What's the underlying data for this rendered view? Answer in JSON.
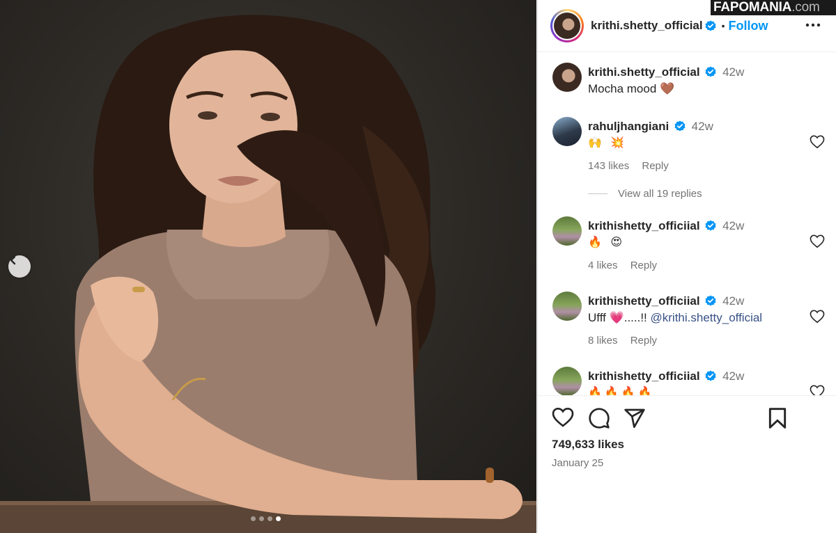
{
  "watermark": {
    "brand": "FAPOMANIA",
    "domain": ".com"
  },
  "post": {
    "author": "krithi.shetty_official",
    "follow_label": "Follow",
    "separator": "•",
    "carousel": {
      "count": 4,
      "active_index": 3
    },
    "likes_text": "749,633 likes",
    "date": "January 25",
    "caption": {
      "username": "krithi.shetty_official",
      "time": "42w",
      "text": "Mocha mood 🤎"
    }
  },
  "comments": [
    {
      "username": "rahuljhangiani",
      "time": "42w",
      "text": "🙌 💥",
      "likes": "143 likes",
      "reply": "Reply"
    },
    {
      "username": "krithishetty_officiial",
      "time": "42w",
      "text": "🔥 😍",
      "likes": "4 likes",
      "reply": "Reply"
    },
    {
      "username": "krithishetty_officiial",
      "time": "42w",
      "text_prefix": "Ufff 💗.....!! ",
      "mention": "@krithi.shetty_official",
      "likes": "8 likes",
      "reply": "Reply"
    },
    {
      "username": "krithishetty_officiial",
      "time": "42w",
      "text": "🔥🔥🔥🔥"
    }
  ],
  "view_replies": "View all 19 replies",
  "icons": {
    "more": "more-icon",
    "like": "heart-icon",
    "comment": "comment-icon",
    "share": "share-icon",
    "save": "bookmark-icon",
    "prev": "chevron-left-icon",
    "verified": "verified-badge-icon"
  },
  "colors": {
    "link": "#0095f6",
    "verified": "#0095f6",
    "muted": "#737373"
  }
}
